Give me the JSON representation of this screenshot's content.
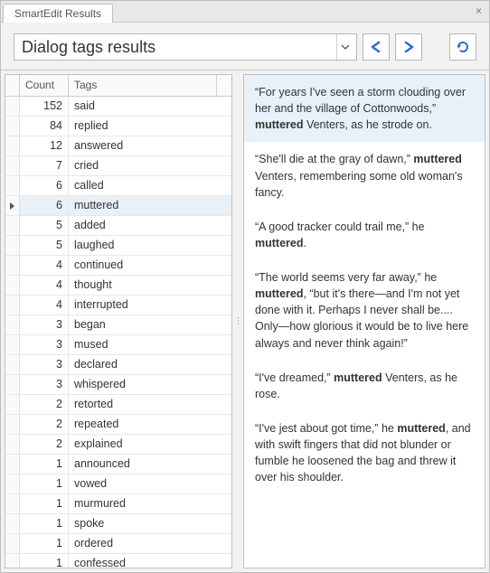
{
  "tab_title": "SmartEdit Results",
  "dropdown_text": "Dialog tags results",
  "columns": {
    "count": "Count",
    "tags": "Tags"
  },
  "rows": [
    {
      "count": 152,
      "tag": "said"
    },
    {
      "count": 84,
      "tag": "replied"
    },
    {
      "count": 12,
      "tag": "answered"
    },
    {
      "count": 7,
      "tag": "cried"
    },
    {
      "count": 6,
      "tag": "called"
    },
    {
      "count": 6,
      "tag": "muttered",
      "selected": true
    },
    {
      "count": 5,
      "tag": "added"
    },
    {
      "count": 5,
      "tag": "laughed"
    },
    {
      "count": 4,
      "tag": "continued"
    },
    {
      "count": 4,
      "tag": "thought"
    },
    {
      "count": 4,
      "tag": "interrupted"
    },
    {
      "count": 3,
      "tag": "began"
    },
    {
      "count": 3,
      "tag": "mused"
    },
    {
      "count": 3,
      "tag": "declared"
    },
    {
      "count": 3,
      "tag": "whispered"
    },
    {
      "count": 2,
      "tag": "retorted"
    },
    {
      "count": 2,
      "tag": "repeated"
    },
    {
      "count": 2,
      "tag": "explained"
    },
    {
      "count": 1,
      "tag": "announced"
    },
    {
      "count": 1,
      "tag": "vowed"
    },
    {
      "count": 1,
      "tag": "murmured"
    },
    {
      "count": 1,
      "tag": "spoke"
    },
    {
      "count": 1,
      "tag": "ordered"
    },
    {
      "count": 1,
      "tag": "confessed"
    }
  ],
  "quotes": [
    "“For years I've seen a storm clouding over her and the village of Cottonwoods,” <b>muttered</b> Venters, as he strode on.",
    "“She'll die at the gray of dawn,” <b>muttered</b> Venters, remembering some old woman's fancy.",
    "“A good tracker could trail me,” he <b>muttered</b>.",
    "“The world seems very far away,” he <b>muttered</b>, “but it's there—and I'm not yet done with it. Perhaps I never shall be.... Only—how glorious it would be to live here always and never think again!”",
    "“I've dreamed,” <b>muttered</b> Venters, as he rose.",
    "“I've jest about got time,” he <b>muttered</b>, and with swift fingers that did not blunder or fumble he loosened the bag and threw it over his shoulder."
  ],
  "icons": {
    "close": "×",
    "dropdown": "chevron-down-icon",
    "back": "arrow-left-icon",
    "forward": "arrow-right-icon",
    "refresh": "refresh-icon"
  }
}
